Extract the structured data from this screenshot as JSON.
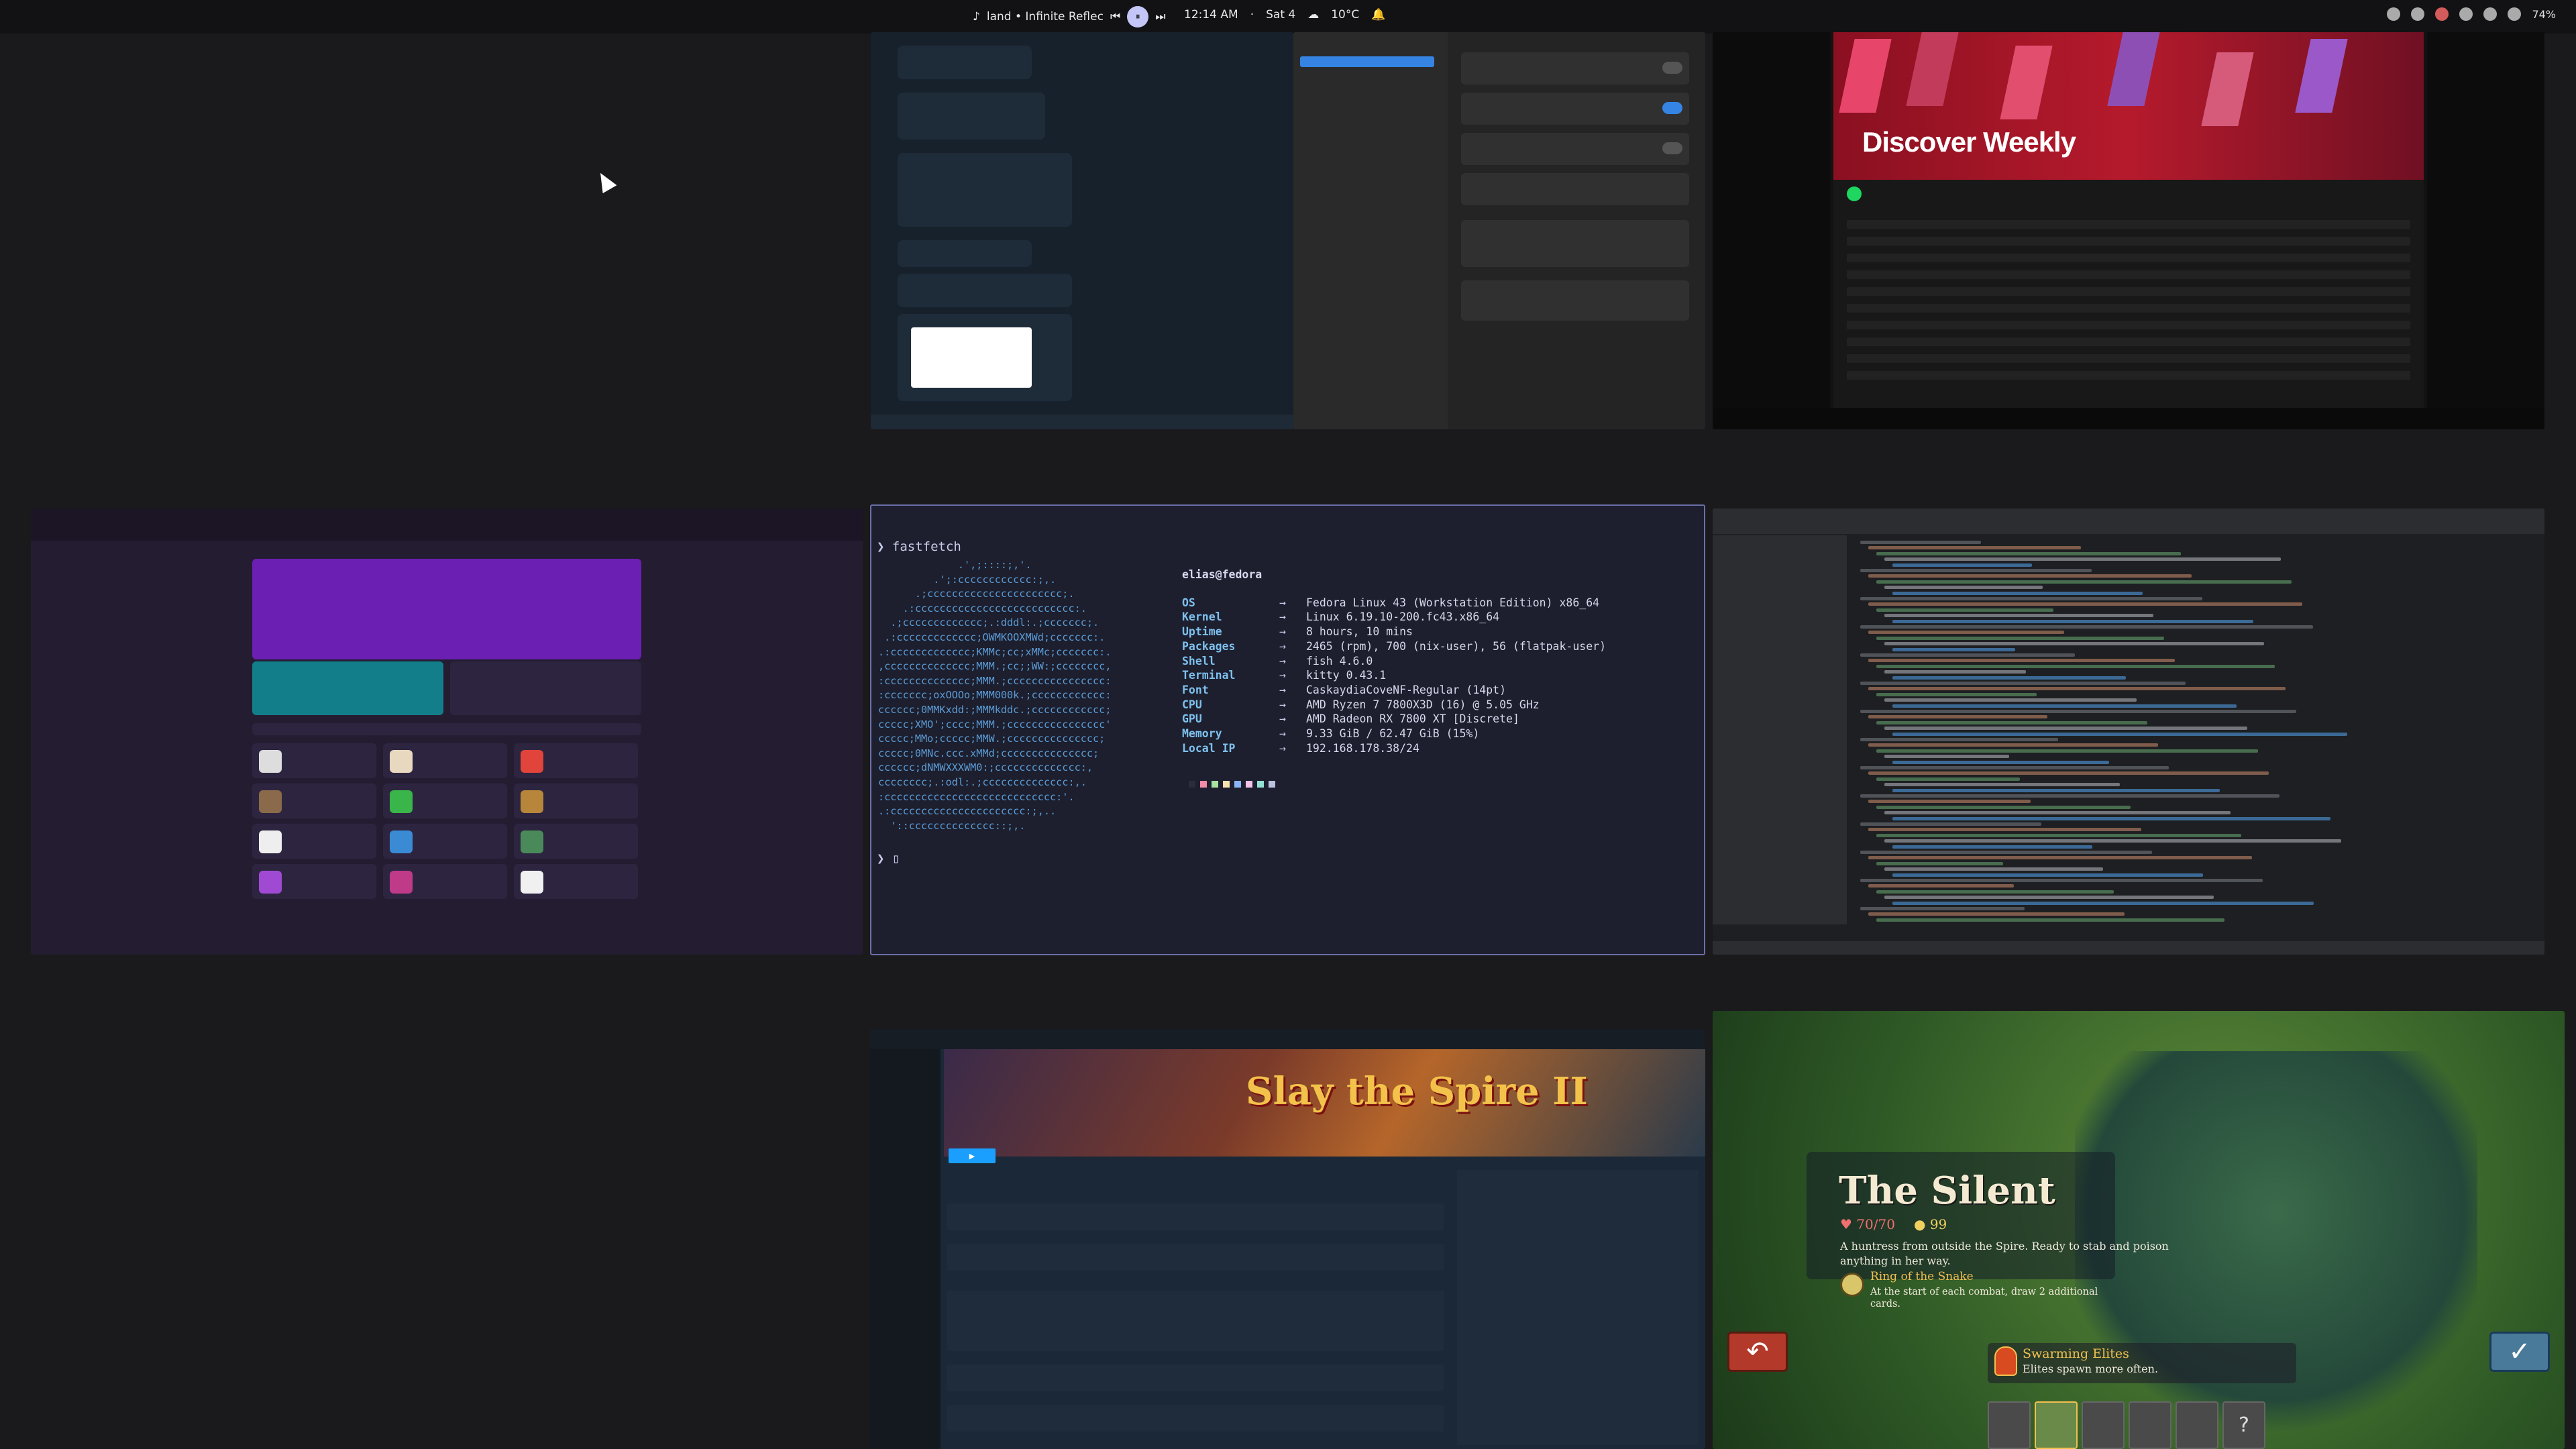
{
  "topbar": {
    "media_title": "land • Infinite Reflec",
    "time": "12:14 AM",
    "day": "Sat 4",
    "weather": "10°C",
    "battery": "74%"
  },
  "spotify": {
    "playlist_title": "Discover Weekly"
  },
  "terminal": {
    "command": "fastfetch",
    "user_host": "elias@fedora",
    "logo_lines": [
      "             .',;::::;,'.",
      "         .';:cccccccccccc:;,.",
      "      .;cccccccccccccccccccccc;.",
      "    .:cccccccccccccccccccccccccc:.",
      "  .;ccccccccccccc;.:dddl:.;ccccccc;.",
      " .:ccccccccccccc;OWMKOOXMWd;ccccccc:.",
      ".:ccccccccccccc;KMMc;cc;xMMc;ccccccc:.",
      ",cccccccccccccc;MMM.;cc;;WW:;cccccccc,",
      ":cccccccccccccc;MMM.;cccccccccccccccc:",
      ":ccccccc;oxOOOo;MMM000k.;cccccccccccc:",
      "cccccc;0MMKxdd:;MMMkddc.;cccccccccccc;",
      "ccccc;XMO';cccc;MMM.;cccccccccccccccc'",
      "ccccc;MMo;ccccc;MMW.;ccccccccccccccc;",
      "ccccc;0MNc.ccc.xMMd;ccccccccccccccc;",
      "cccccc;dNMWXXXWM0:;cccccccccccccc:,",
      "cccccccc;.:odl:.;cccccccccccccc:,.",
      ":cccccccccccccccccccccccccccc:'.",
      ".:cccccccccccccccccccccc:;,..",
      "  '::cccccccccccccc::;,."
    ],
    "info": [
      {
        "label": "OS",
        "value": "Fedora Linux 43 (Workstation Edition) x86_64"
      },
      {
        "label": "Kernel",
        "value": "Linux 6.19.10-200.fc43.x86_64"
      },
      {
        "label": "Uptime",
        "value": "8 hours, 10 mins"
      },
      {
        "label": "Packages",
        "value": "2465 (rpm), 700 (nix-user), 56 (flatpak-user)"
      },
      {
        "label": "Shell",
        "value": "fish 4.6.0"
      },
      {
        "label": "Terminal",
        "value": "kitty 0.43.1"
      },
      {
        "label": "Font",
        "value": "CaskaydiaCoveNF-Regular (14pt)"
      },
      {
        "label": "CPU",
        "value": "AMD Ryzen 7 7800X3D (16) @ 5.05 GHz"
      },
      {
        "label": "GPU",
        "value": "AMD Radeon RX 7800 XT [Discrete]"
      },
      {
        "label": "Memory",
        "value": "9.33 GiB / 62.47 GiB (15%)"
      },
      {
        "label": "Local IP",
        "value": "192.168.178.38/24"
      }
    ],
    "palette": [
      "#2a2c3a",
      "#f38ba8",
      "#a6e3a1",
      "#f9e2af",
      "#89b4fa",
      "#f5c2e7",
      "#94e2d5",
      "#bac2de"
    ]
  },
  "steam": {
    "game_title": "Slay the Spire II"
  },
  "game": {
    "character": "The Silent",
    "hp": "70/70",
    "gold": "99",
    "description": "A huntress from outside the Spire. Ready to stab and poison anything in her way.",
    "relic_name": "Ring of the Snake",
    "relic_desc": "At the start of each combat, draw 2 additional cards.",
    "modifier_title": "Swarming Elites",
    "modifier_desc": "Elites spawn more often."
  }
}
